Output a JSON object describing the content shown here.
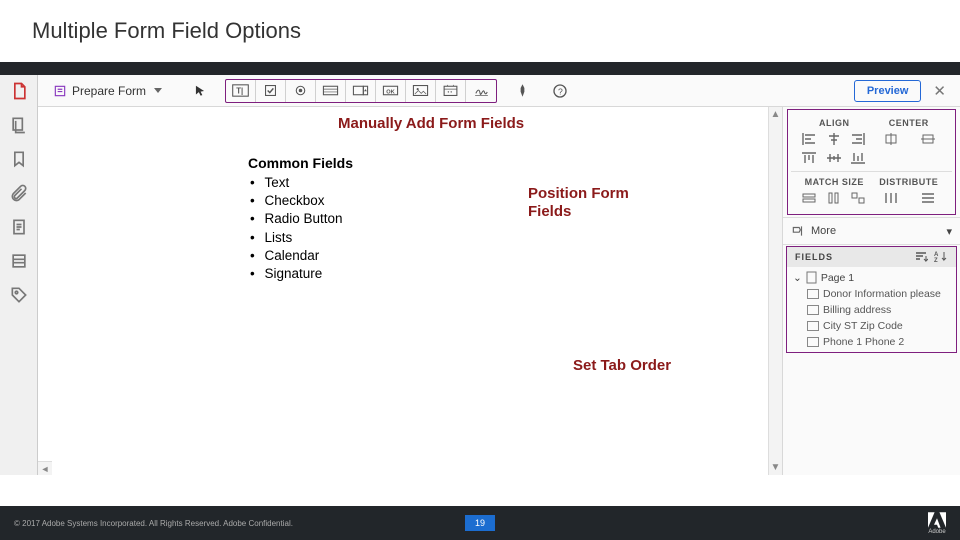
{
  "title": "Multiple Form Field Options",
  "toolbar": {
    "prepare_label": "Prepare Form",
    "preview_label": "Preview",
    "field_tools": [
      "text-field",
      "checkbox",
      "radio",
      "combo",
      "list",
      "ok-button",
      "image",
      "date",
      "signature"
    ]
  },
  "callouts": {
    "manually": {
      "heading": "Manually Add Form Fields",
      "subheading": "Common Fields",
      "items": [
        "Text",
        "Checkbox",
        "Radio Button",
        "Lists",
        "Calendar",
        "Signature"
      ]
    },
    "position": {
      "heading": "Position Form Fields"
    },
    "tab": {
      "heading": "Set Tab Order"
    }
  },
  "rightPane": {
    "align_label": "ALIGN",
    "center_label": "CENTER",
    "match_label": "MATCH SIZE",
    "distribute_label": "DISTRIBUTE",
    "more_label": "More",
    "fields_label": "FIELDS",
    "page_label": "Page 1",
    "field_items": [
      "Donor Information please",
      "Billing address",
      "City ST  Zip Code",
      "Phone 1  Phone 2"
    ]
  },
  "footer": {
    "copyright": "© 2017 Adobe Systems Incorporated.  All Rights Reserved.  Adobe Confidential.",
    "page": "19",
    "brand": "Adobe"
  }
}
